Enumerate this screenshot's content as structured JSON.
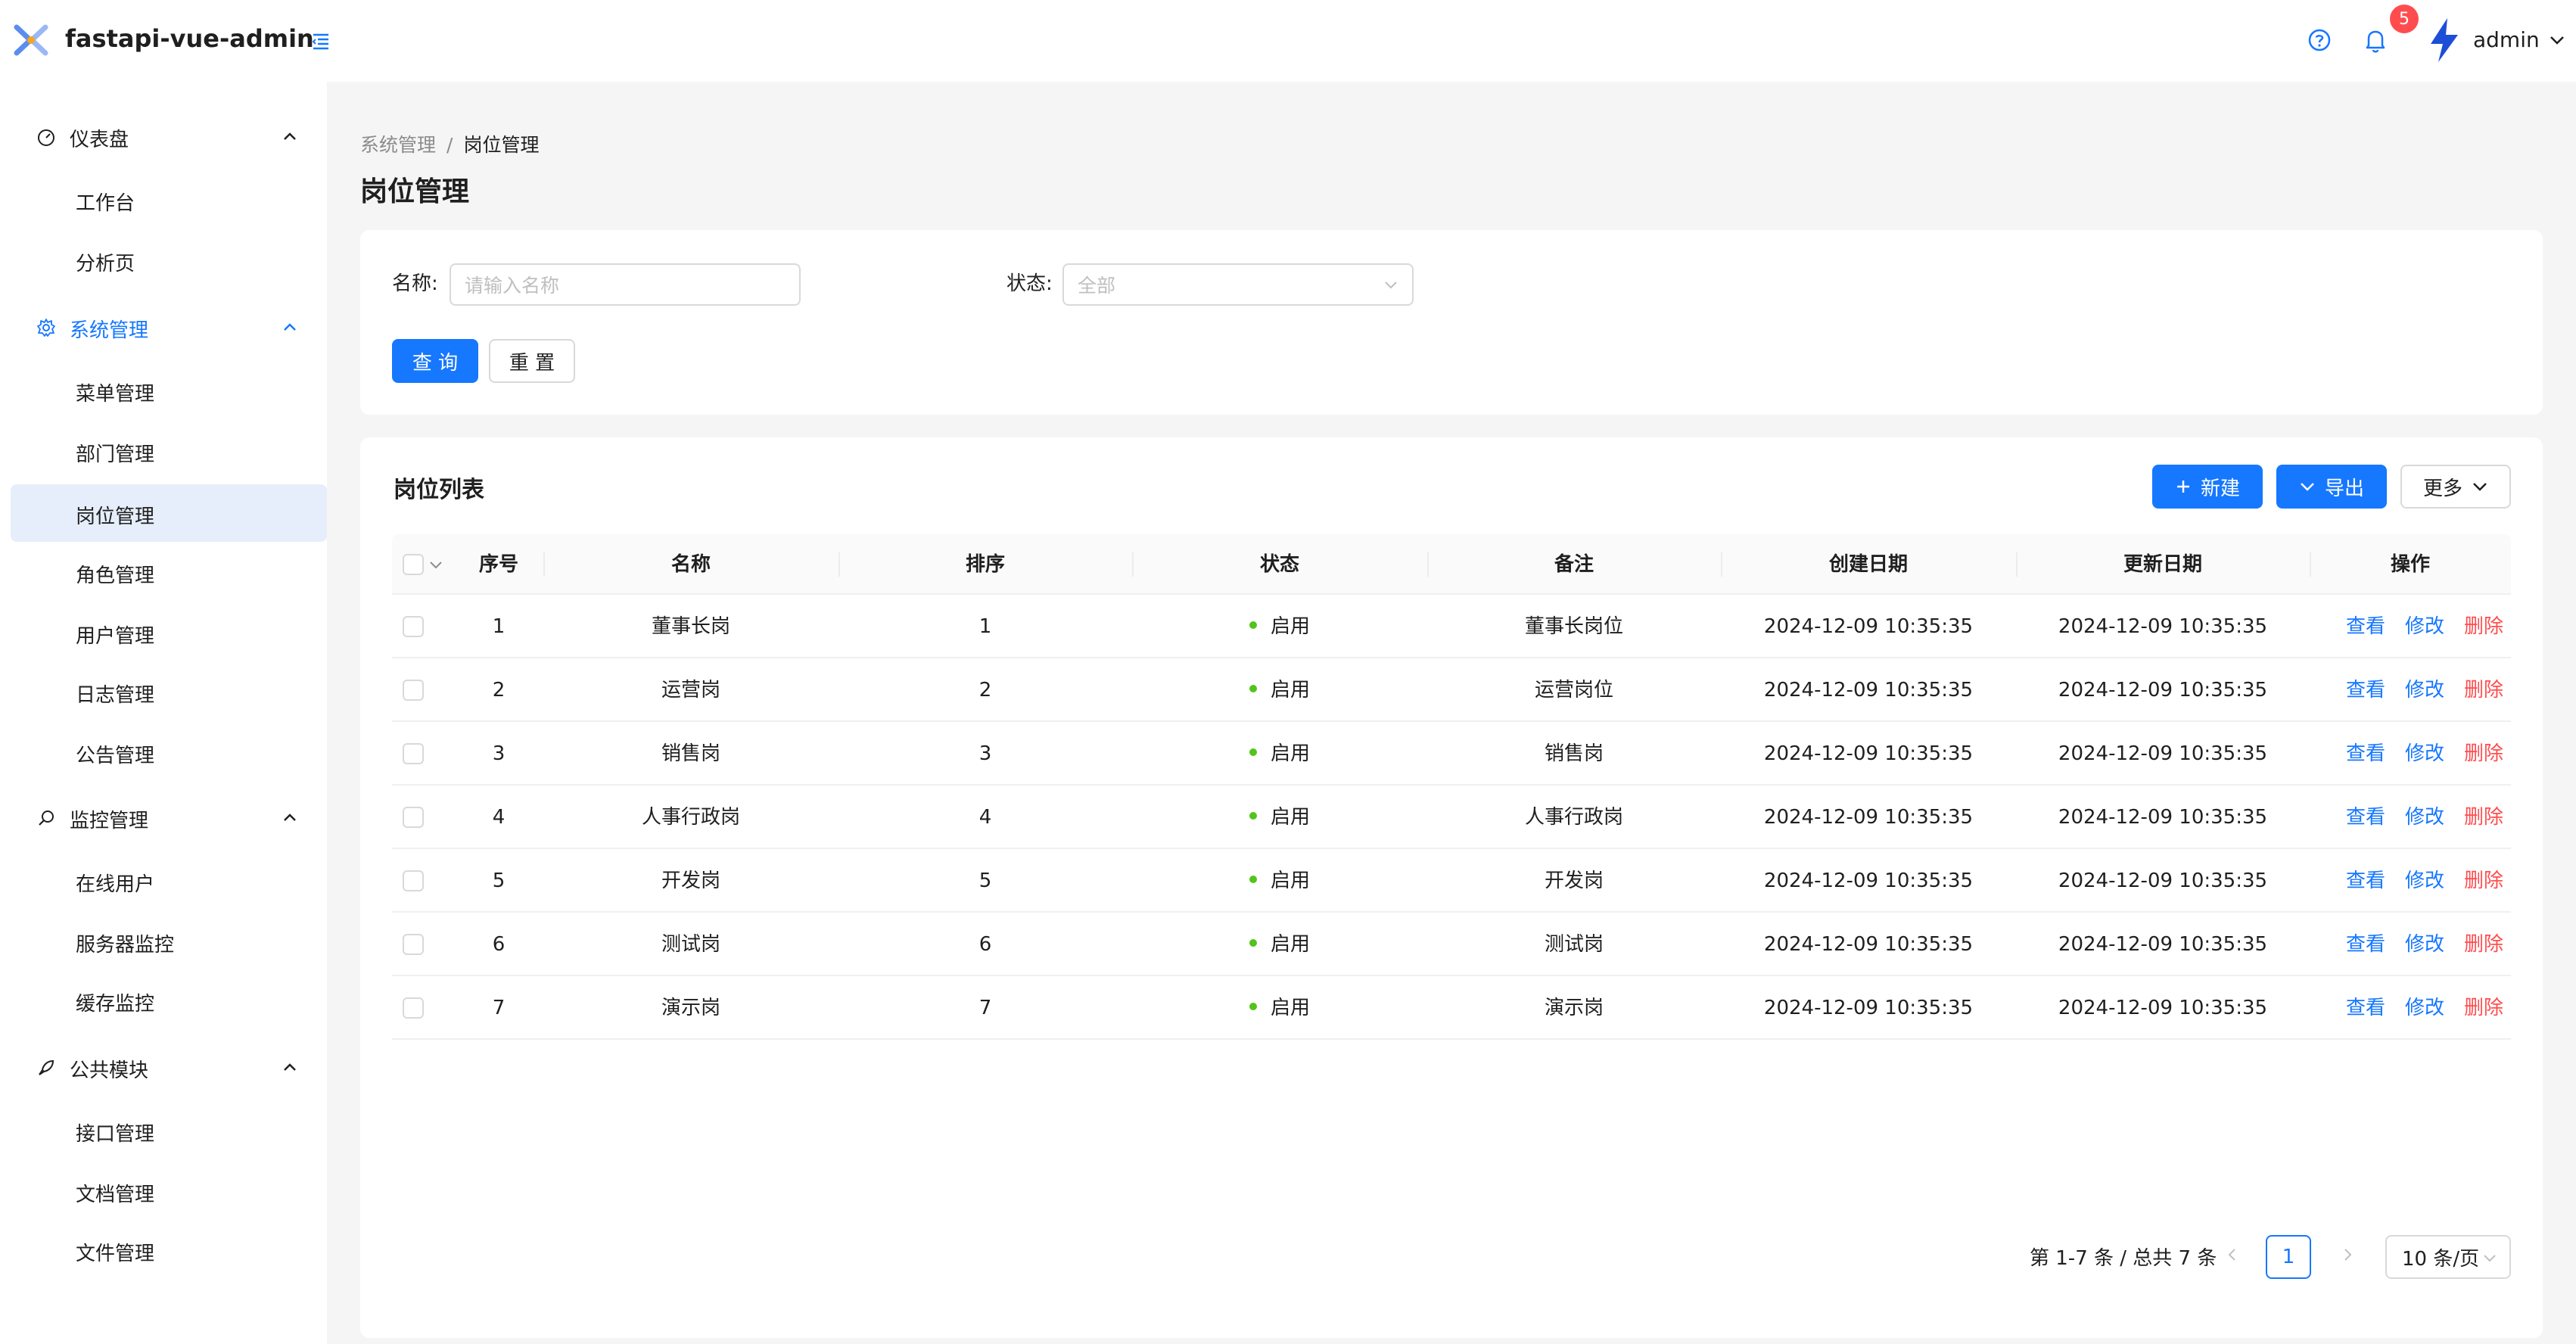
{
  "app": {
    "title": "fastapi-vue-admin"
  },
  "header": {
    "notification_count": "5",
    "username": "admin"
  },
  "sidebar": {
    "groups": [
      {
        "label": "仪表盘",
        "items": [
          "工作台",
          "分析页"
        ]
      },
      {
        "label": "系统管理",
        "items": [
          "菜单管理",
          "部门管理",
          "岗位管理",
          "角色管理",
          "用户管理",
          "日志管理",
          "公告管理"
        ]
      },
      {
        "label": "监控管理",
        "items": [
          "在线用户",
          "服务器监控",
          "缓存监控"
        ]
      },
      {
        "label": "公共模块",
        "items": [
          "接口管理",
          "文档管理",
          "文件管理"
        ]
      }
    ],
    "selected_item": "岗位管理"
  },
  "breadcrumb": {
    "parent": "系统管理",
    "separator": "/",
    "current": "岗位管理"
  },
  "page_title": "岗位管理",
  "search": {
    "name_label": "名称:",
    "name_placeholder": "请输入名称",
    "status_label": "状态:",
    "status_value": "全部",
    "query_label": "查 询",
    "reset_label": "重 置"
  },
  "table": {
    "title": "岗位列表",
    "new_label": "新建",
    "export_label": "导出",
    "more_label": "更多",
    "columns": [
      "序号",
      "名称",
      "排序",
      "状态",
      "备注",
      "创建日期",
      "更新日期",
      "操作"
    ],
    "rows": [
      {
        "index": "1",
        "name": "董事长岗",
        "order": "1",
        "status": "启用",
        "remark": "董事长岗位",
        "created": "2024-12-09 10:35:35",
        "updated": "2024-12-09 10:35:35"
      },
      {
        "index": "2",
        "name": "运营岗",
        "order": "2",
        "status": "启用",
        "remark": "运营岗位",
        "created": "2024-12-09 10:35:35",
        "updated": "2024-12-09 10:35:35"
      },
      {
        "index": "3",
        "name": "销售岗",
        "order": "3",
        "status": "启用",
        "remark": "销售岗",
        "created": "2024-12-09 10:35:35",
        "updated": "2024-12-09 10:35:35"
      },
      {
        "index": "4",
        "name": "人事行政岗",
        "order": "4",
        "status": "启用",
        "remark": "人事行政岗",
        "created": "2024-12-09 10:35:35",
        "updated": "2024-12-09 10:35:35"
      },
      {
        "index": "5",
        "name": "开发岗",
        "order": "5",
        "status": "启用",
        "remark": "开发岗",
        "created": "2024-12-09 10:35:35",
        "updated": "2024-12-09 10:35:35"
      },
      {
        "index": "6",
        "name": "测试岗",
        "order": "6",
        "status": "启用",
        "remark": "测试岗",
        "created": "2024-12-09 10:35:35",
        "updated": "2024-12-09 10:35:35"
      },
      {
        "index": "7",
        "name": "演示岗",
        "order": "7",
        "status": "启用",
        "remark": "演示岗",
        "created": "2024-12-09 10:35:35",
        "updated": "2024-12-09 10:35:35"
      }
    ],
    "actions": {
      "view": "查看",
      "edit": "修改",
      "delete": "删除"
    }
  },
  "pagination": {
    "total_text": "第 1-7 条 / 总共 7 条",
    "current_page": "1",
    "page_size": "10 条/页"
  },
  "colors": {
    "primary": "#1677ff",
    "danger": "#ff4d4f",
    "success": "#52c41a",
    "selected_bg": "#e6eefb"
  }
}
